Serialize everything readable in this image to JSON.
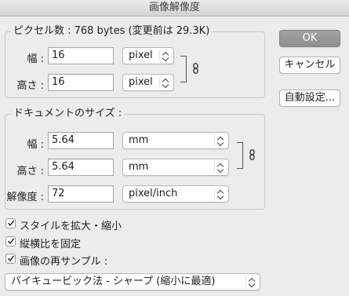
{
  "window": {
    "title": "画像解像度"
  },
  "pixel_group": {
    "legend": "ピクセル数 : 768 bytes (変更前は 29.3K)",
    "width_label": "幅 :",
    "width_value": "16",
    "width_unit": "pixel",
    "height_label": "高さ :",
    "height_value": "16",
    "height_unit": "pixel"
  },
  "document_group": {
    "legend": "ドキュメントのサイズ :",
    "width_label": "幅 :",
    "width_value": "5.64",
    "width_unit": "mm",
    "height_label": "高さ :",
    "height_value": "5.64",
    "height_unit": "mm",
    "resolution_label": "解像度 :",
    "resolution_value": "72",
    "resolution_unit": "pixel/inch"
  },
  "buttons": {
    "ok": "OK",
    "cancel": "キャンセル",
    "auto": "自動設定..."
  },
  "options": {
    "scale_styles": {
      "label": "スタイルを拡大・縮小",
      "checked": true
    },
    "constrain": {
      "label": "縦横比を固定",
      "checked": true
    },
    "resample": {
      "label": "画像の再サンプル :",
      "checked": true
    }
  },
  "resample_method": "バイキュービック法 - シャープ (縮小に最適)",
  "colors": {
    "default_button": "#999999",
    "window_bg": "#ececec"
  },
  "icons": [
    "link-chain-icon",
    "checkmark-icon",
    "chevron-up-down-icon"
  ]
}
